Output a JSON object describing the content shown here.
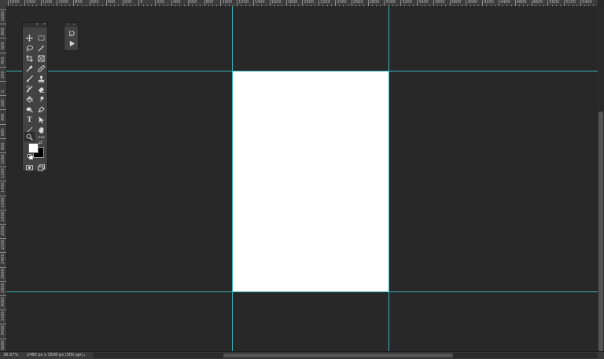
{
  "ruler": {
    "top_labels": [
      "1600",
      "1400",
      "1200",
      "1000",
      "800",
      "600",
      "400",
      "200",
      "0",
      "200",
      "400",
      "600",
      "800",
      "1000",
      "1200",
      "1400",
      "1600",
      "1800",
      "2000",
      "2200",
      "2400",
      "2600",
      "2800",
      "3000",
      "3200",
      "3400",
      "3600",
      "3800",
      "4000",
      "4200",
      "4400",
      "4600",
      "4800",
      "5000",
      "5200",
      "5400"
    ],
    "left_labels": [
      "1000",
      "800",
      "600",
      "400",
      "200",
      "0",
      "200",
      "400",
      "600",
      "800",
      "1000",
      "1200",
      "1400",
      "1600",
      "1800",
      "2000",
      "2200",
      "2400",
      "2600",
      "2800",
      "3000",
      "3200",
      "3400",
      "3600"
    ]
  },
  "status": {
    "zoom": "36.67%",
    "doc_info": "2480 px x 3508 px (300 ppi)",
    "arrow": "›"
  },
  "toolbar": {
    "header_collapse": "«",
    "header_close": "×",
    "tools": [
      [
        "move-tool-icon",
        "rectangular-marquee-tool-icon"
      ],
      [
        "lasso-tool-icon",
        "magic-wand-tool-icon"
      ],
      [
        "crop-tool-icon",
        "frame-tool-icon"
      ],
      [
        "eyedropper-tool-icon",
        "ruler-tool-icon"
      ],
      [
        "brush-tool-icon",
        "clone-stamp-tool-icon"
      ],
      [
        "history-brush-tool-icon",
        "eraser-tool-icon"
      ],
      [
        "paint-bucket-tool-icon",
        "smudge-tool-icon"
      ],
      [
        "dodge-tool-icon",
        "pen-tool-icon"
      ],
      [
        "type-tool-icon",
        "path-selection-tool-icon"
      ],
      [
        "line-tool-icon",
        "hand-tool-icon"
      ],
      [
        "zoom-tool-icon",
        "more-tools-icon"
      ]
    ],
    "type_tool_glyph": "T",
    "swap_glyph": "⇄",
    "foreground_color": "#ffffff",
    "background_color": "#000000"
  },
  "actions_panel": {
    "header_collapse": "«",
    "header_close": "×"
  },
  "colors": {
    "workspace": "#282828",
    "guide": "#38c8d0",
    "document": "#ffffff"
  }
}
